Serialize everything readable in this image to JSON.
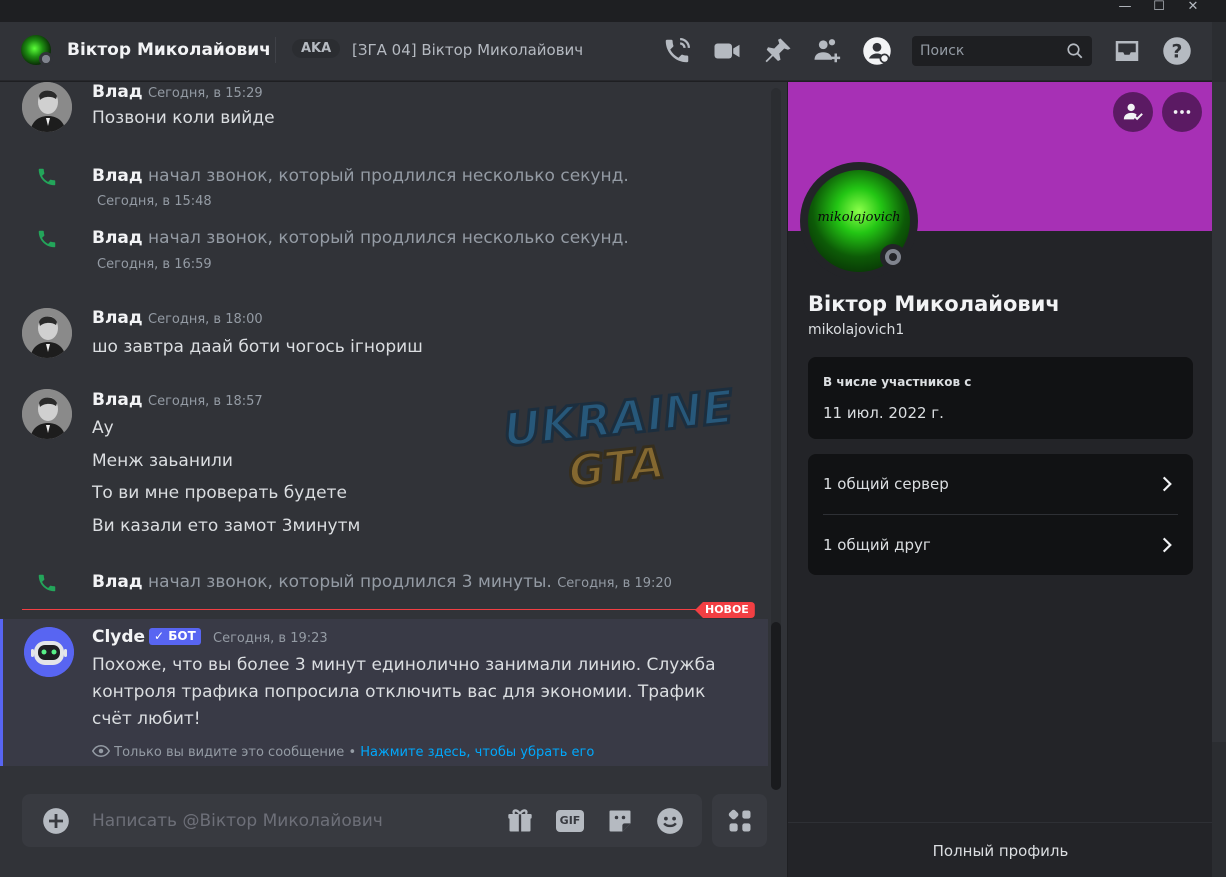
{
  "window": {
    "minimize": "—",
    "maximize": "☐",
    "close": "✕"
  },
  "header": {
    "name": "Віктор Миколайович",
    "aka": "AKA",
    "server_nick": "[ЗГА 04] Віктор Миколайович",
    "search_placeholder": "Поиск"
  },
  "messages": [
    {
      "author": "Влад",
      "time": "Сегодня, в 15:29",
      "lines": [
        "Позвони коли вийде"
      ]
    },
    {
      "author": "Влад",
      "time": "Сегодня, в 18:00",
      "lines": [
        "шо завтра даай боти чогось ігнориш"
      ]
    },
    {
      "author": "Влад",
      "time": "Сегодня, в 18:57",
      "lines": [
        "Ау",
        "Менж заьанили",
        "То ви мне проверать будете",
        "Ви казали ето замот 3минутм"
      ]
    }
  ],
  "calls": [
    {
      "author": "Влад",
      "text": "начал звонок, который продлился несколько секунд.",
      "time": "Сегодня, в 15:48"
    },
    {
      "author": "Влад",
      "text": "начал звонок, который продлился несколько секунд.",
      "time": "Сегодня, в 16:59"
    },
    {
      "author": "Влад",
      "text": "начал звонок, который продлился 3 минуты.",
      "time": "Сегодня, в 19:20"
    }
  ],
  "new_badge": "НОВОЕ",
  "bot_message": {
    "author": "Clyde",
    "tag": "✓ БОТ",
    "time": "Сегодня, в 19:23",
    "text": "Похоже, что вы более 3 минут единолично занимали линию. Служба контроля трафика попросила отключить вас для экономии. Трафик счёт любит!",
    "ephemeral_note": "Только вы видите это сообщение •",
    "dismiss_link": "Нажмите здесь, чтобы убрать его"
  },
  "composer": {
    "placeholder": "Написать @Віктор Миколайович",
    "gif_label": "GIF"
  },
  "watermark": {
    "line1": "UKRAINE",
    "line2": "GTA"
  },
  "profile": {
    "banner_color": "#a730b5",
    "avatar_text": "mikolajovich",
    "display_name": "Віктор Миколайович",
    "username": "mikolajovich1",
    "member_since_title": "В числе участников с",
    "member_since_value": "11 июл. 2022 г.",
    "mutual_servers": "1 общий сервер",
    "mutual_friends": "1 общий друг",
    "full_profile": "Полный профиль"
  },
  "colors": {
    "accent": "#5865f2",
    "call_green": "#23a55a",
    "new_red": "#f23f43",
    "link": "#00a8fc"
  }
}
